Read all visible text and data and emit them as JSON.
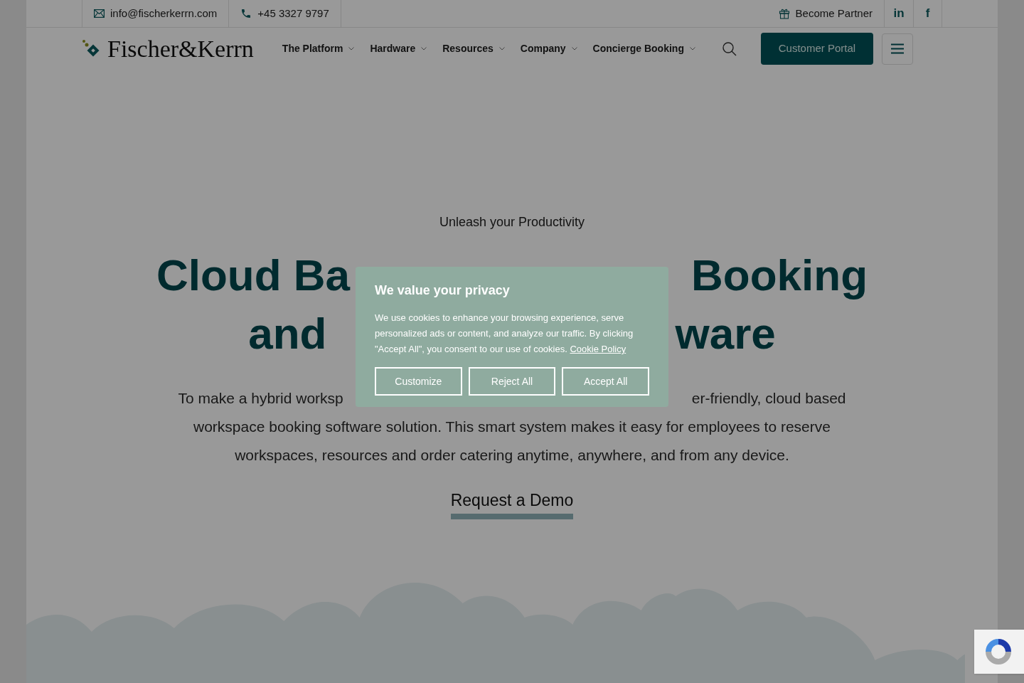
{
  "topbar": {
    "email": "info@fischerkerrn.com",
    "phone": "+45 3327 9797",
    "partner": "Become Partner",
    "social": [
      "in",
      "f"
    ]
  },
  "header": {
    "logo": "Fischer&Kerrn",
    "nav": [
      "The Platform",
      "Hardware",
      "Resources",
      "Company",
      "Concierge Booking"
    ],
    "cta": "Customer Portal"
  },
  "hero": {
    "eyebrow": "Unleash your Productivity",
    "heading_lines": [
      [
        "Cloud Ba",
        "Booking"
      ],
      [
        "and",
        "ware"
      ]
    ],
    "paragraph_lines": [
      [
        "To make a hybrid worksp",
        "er-friendly, cloud based"
      ],
      [
        "workspace booking software solution. This smart system makes it easy for employees to reserve"
      ],
      [
        "workspaces, resources and order catering anytime, anywhere, and from any device."
      ]
    ],
    "button": "Request a Demo"
  },
  "cookie_dialog": {
    "title": "We value your privacy",
    "body": "We use cookies to enhance your browsing experience, serve personalized ads or content, and analyze our traffic. By clicking \"Accept All\", you consent to our use of cookies.",
    "link": "Cookie Policy",
    "buttons": [
      "Customize",
      "Reject All",
      "Accept All"
    ]
  }
}
